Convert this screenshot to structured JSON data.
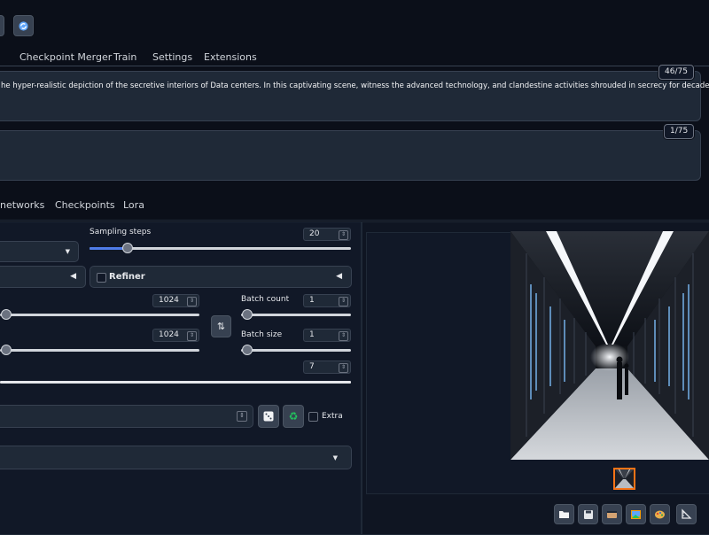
{
  "tabs": [
    "Checkpoint Merger",
    "Train",
    "Settings",
    "Extensions"
  ],
  "prompt": {
    "text": "he hyper-realistic depiction of the secretive interiors of Data centers. In this captivating scene, witness the advanced technology, and clandestine activities shrouded in secrecy for decades.",
    "token_count": "46/75"
  },
  "negative_prompt": {
    "text": "",
    "token_count": "1/75"
  },
  "extra_tabs": [
    "networks",
    "Checkpoints",
    "Lora"
  ],
  "sampling_steps": {
    "label": "Sampling steps",
    "value": "20",
    "fraction": 0.2
  },
  "refiner": {
    "label": "Refiner",
    "checked": false
  },
  "width": {
    "value": "1024"
  },
  "height": {
    "value": "1024"
  },
  "batch_count": {
    "label": "Batch count",
    "value": "1"
  },
  "batch_size": {
    "label": "Batch size",
    "value": "1"
  },
  "cfg_scale": {
    "value": "7"
  },
  "seed": {
    "extra_label": "Extra"
  },
  "icons": {
    "swap": "swap-dimensions-icon",
    "dice": "dice-icon",
    "recycle": "recycle-icon",
    "folder": "folder-icon",
    "save": "save-icon",
    "zip": "zip-icon",
    "image": "image-icon",
    "palette": "palette-icon",
    "ruler": "ruler-icon"
  },
  "colors": {
    "accent": "#4f7ce8",
    "background": "#0b0f19",
    "panel": "#1f2937"
  }
}
